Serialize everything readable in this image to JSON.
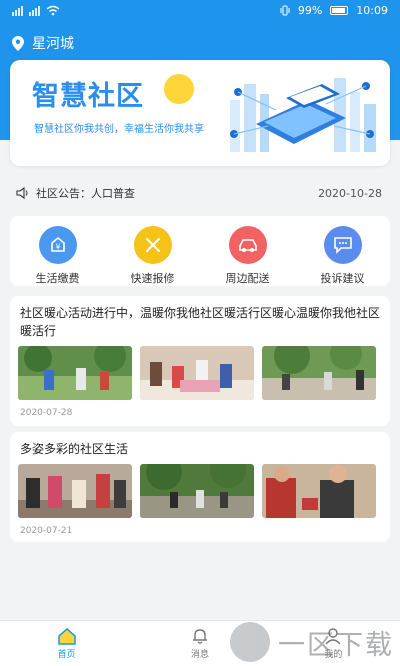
{
  "status_bar": {
    "battery": "99%",
    "time": "10:09"
  },
  "location": {
    "city": "星河城"
  },
  "banner": {
    "title": "智慧社区",
    "subtitle": "智慧社区你我共创，幸福生活你我共享"
  },
  "notice": {
    "label": "社区公告：",
    "text": "人口普查",
    "date": "2020-10-28"
  },
  "services": [
    {
      "label": "生活缴费",
      "icon": "yuan-icon",
      "color": "#4a98f0"
    },
    {
      "label": "快速报修",
      "icon": "tools-icon",
      "color": "#f5c218"
    },
    {
      "label": "周边配送",
      "icon": "car-icon",
      "color": "#f26262"
    },
    {
      "label": "投诉建议",
      "icon": "chat-icon",
      "color": "#5a8cf0"
    }
  ],
  "articles": [
    {
      "title": "社区暖心活动进行中，温暖你我他社区暖活行区暖心温暖你我他社区暖活行",
      "date": "2020-07-28"
    },
    {
      "title": "多姿多彩的社区生活",
      "date": "2020-07-21"
    }
  ],
  "tabs": [
    {
      "label": "首页",
      "icon": "home-icon",
      "active": true
    },
    {
      "label": "消息",
      "icon": "bell-icon",
      "active": false
    },
    {
      "label": "我的",
      "icon": "user-icon",
      "active": false
    }
  ],
  "watermark": {
    "text": "一区下载"
  },
  "colors": {
    "primary": "#1f94ec",
    "background": "#f2f3f5"
  }
}
